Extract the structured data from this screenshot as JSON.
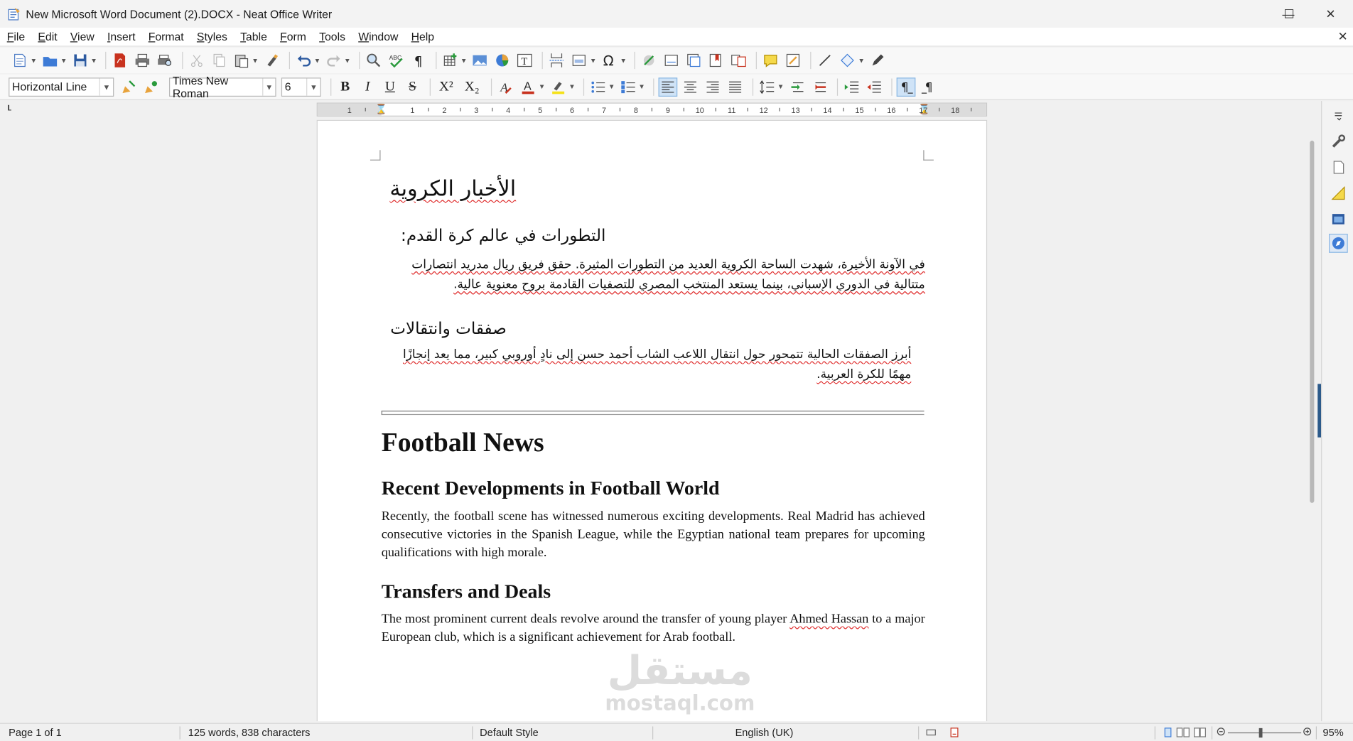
{
  "window": {
    "title": "New Microsoft Word Document (2).DOCX - Neat Office Writer",
    "controls": {
      "minimize": "—",
      "maximize": "☐",
      "close": "✕"
    }
  },
  "menu": {
    "items": [
      {
        "u": "F",
        "rest": "ile"
      },
      {
        "u": "E",
        "rest": "dit"
      },
      {
        "u": "V",
        "rest": "iew"
      },
      {
        "u": "I",
        "rest": "nsert"
      },
      {
        "u": "F",
        "rest": "ormat"
      },
      {
        "u": "S",
        "rest": "tyles"
      },
      {
        "u": "T",
        "rest": "able"
      },
      {
        "u": "F",
        "rest": "orm"
      },
      {
        "u": "T",
        "rest": "ools"
      },
      {
        "u": "W",
        "rest": "indow"
      },
      {
        "u": "H",
        "rest": "elp"
      }
    ],
    "doc_close": "✕"
  },
  "formatting": {
    "paragraph_style": "Horizontal Line",
    "font_name": "Times New Roman",
    "font_size": "6",
    "bold": "B",
    "italic": "I",
    "underline": "U",
    "strike": "S",
    "superscript": "X²",
    "subscript": "X₂"
  },
  "ruler": {
    "ticks": [
      "1",
      "1",
      "2",
      "3",
      "4",
      "5",
      "6",
      "7",
      "8",
      "9",
      "10",
      "11",
      "12",
      "13",
      "14",
      "15",
      "16",
      "17",
      "18"
    ]
  },
  "document": {
    "ar_title": "الأخبار الكروية",
    "ar_heading1": "التطورات  في عالم كرة القدم:",
    "ar_para1": "في الآونة الأخيرة، شهدت الساحة الكروية العديد من التطورات المثيرة. حقق فريق ريال مدريد انتصارات متتالية  في الدوري الإسباني، بينما يستعد المنتخب المصري للتصفيات القادمة بروح معنوية عالية.",
    "ar_heading2": "صفقات وانتقالات",
    "ar_para2": " أبرز الصفقات الحالية تتمحور حول انتقال اللاعب الشاب أحمد حسن إلى نادٍ أوروبي كبير، مما يعد إنجازًا مهمًا للكرة العربية.",
    "en_title": "Football News",
    "en_heading1": "Recent Developments in Football World",
    "en_para1": "Recently, the football scene has witnessed numerous exciting developments. Real Madrid has achieved consecutive victories in the Spanish League, while the Egyptian national team prepares for upcoming qualifications with high morale.",
    "en_heading2": "Transfers and Deals",
    "en_para2_a": "The most prominent current deals revolve around the transfer of young player ",
    "en_para2_name": "Ahmed Hassan",
    "en_para2_b": " to a major European club, which is a significant achievement for Arab football."
  },
  "watermark": {
    "arabic": "مستقل",
    "latin": "mostaql.com"
  },
  "status": {
    "page": "Page 1 of 1",
    "counts": "125 words, 838 characters",
    "style": "Default Style",
    "language": "English (UK)",
    "zoom": "95%"
  },
  "colors": {
    "accent": "#2c5a8a",
    "spell_error": "#e03030",
    "page_bg": "#ffffff",
    "workspace_bg": "#f0f0f0"
  }
}
